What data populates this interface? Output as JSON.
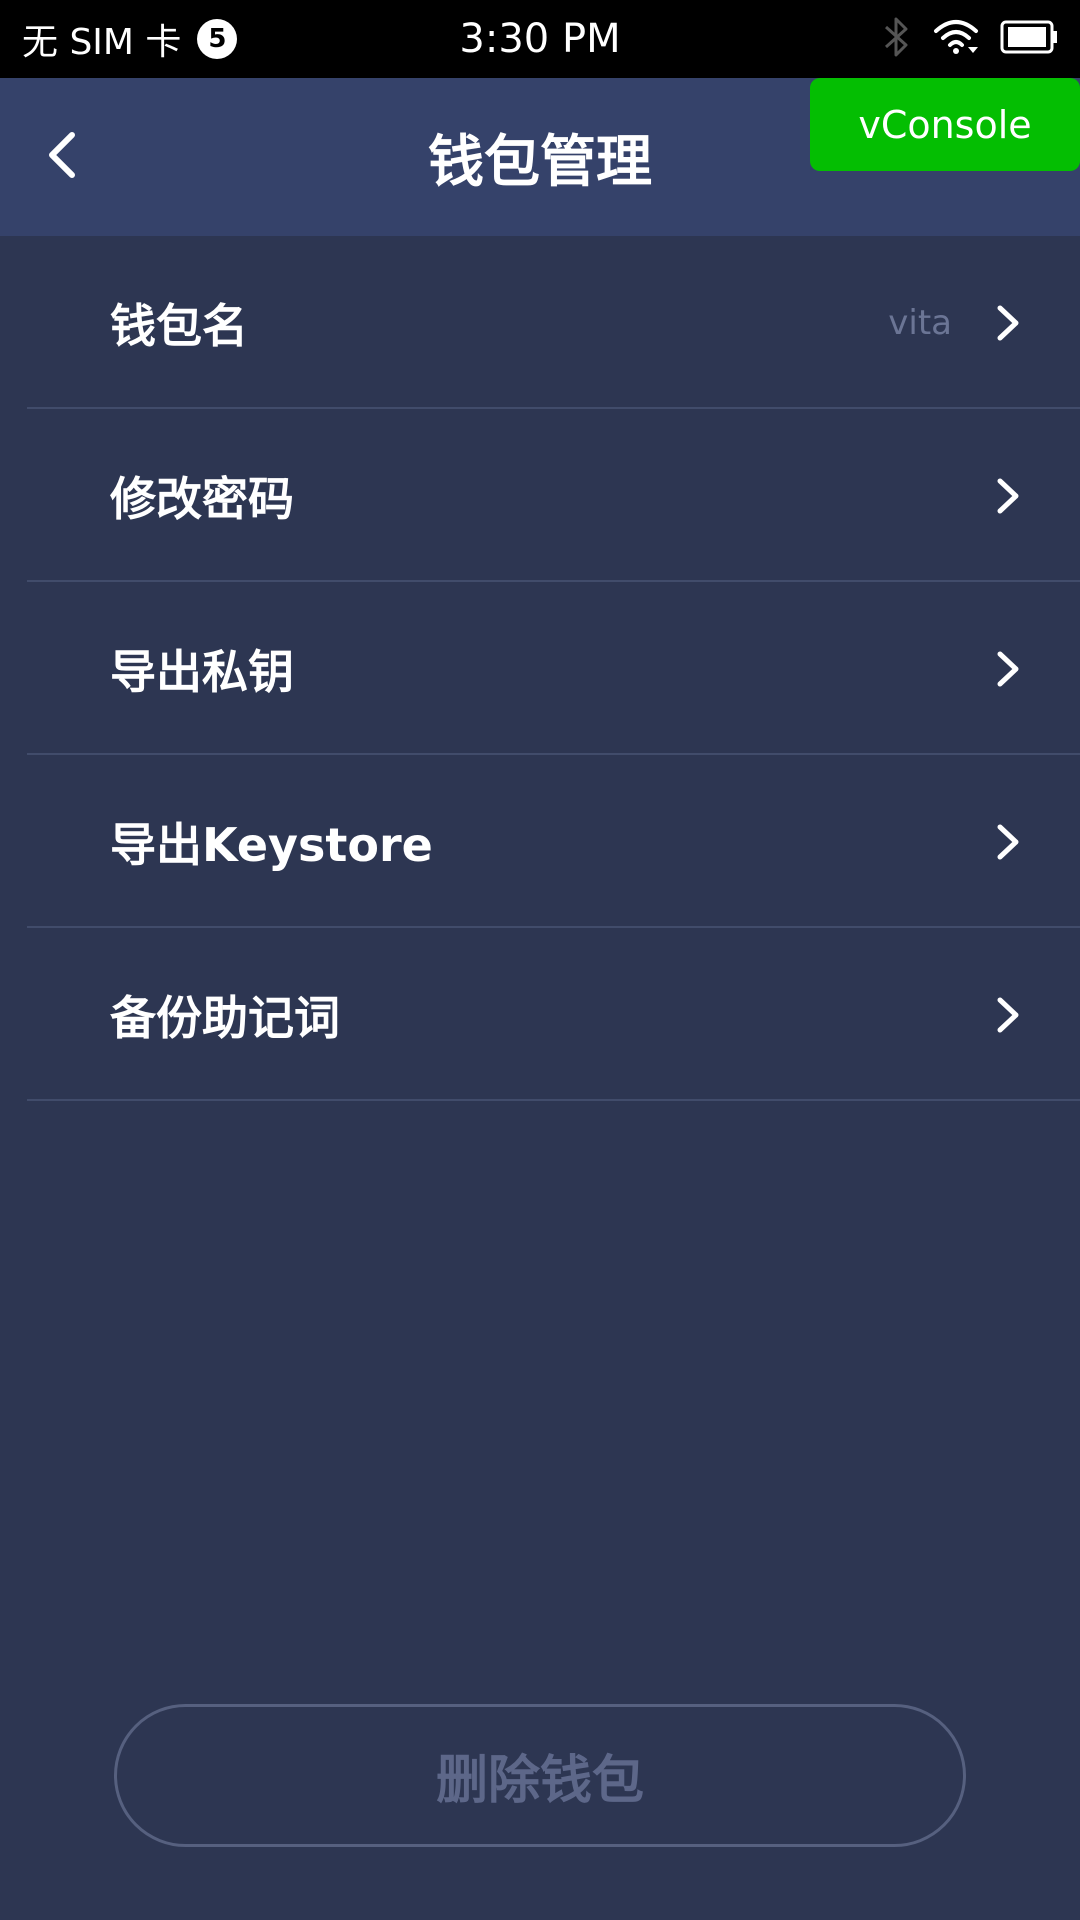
{
  "status_bar": {
    "carrier": "无 SIM 卡",
    "sim_badge": "5",
    "time": "3:30 PM",
    "icons": [
      "bluetooth-icon",
      "wifi-icon",
      "battery-icon"
    ]
  },
  "nav": {
    "title": "钱包管理",
    "back_icon": "chevron-left-icon"
  },
  "vconsole": {
    "label": "vConsole"
  },
  "menu": {
    "items": [
      {
        "label": "钱包名",
        "value": "vita"
      },
      {
        "label": "修改密码",
        "value": ""
      },
      {
        "label": "导出私钥",
        "value": ""
      },
      {
        "label": "导出Keystore",
        "value": ""
      },
      {
        "label": "备份助记词",
        "value": ""
      }
    ]
  },
  "delete": {
    "label": "删除钱包"
  },
  "colors": {
    "background": "#2d3652",
    "nav_background": "#35426a",
    "vconsole_green": "#04be02",
    "divider": "#414c6b",
    "muted_text": "#5d6789"
  }
}
